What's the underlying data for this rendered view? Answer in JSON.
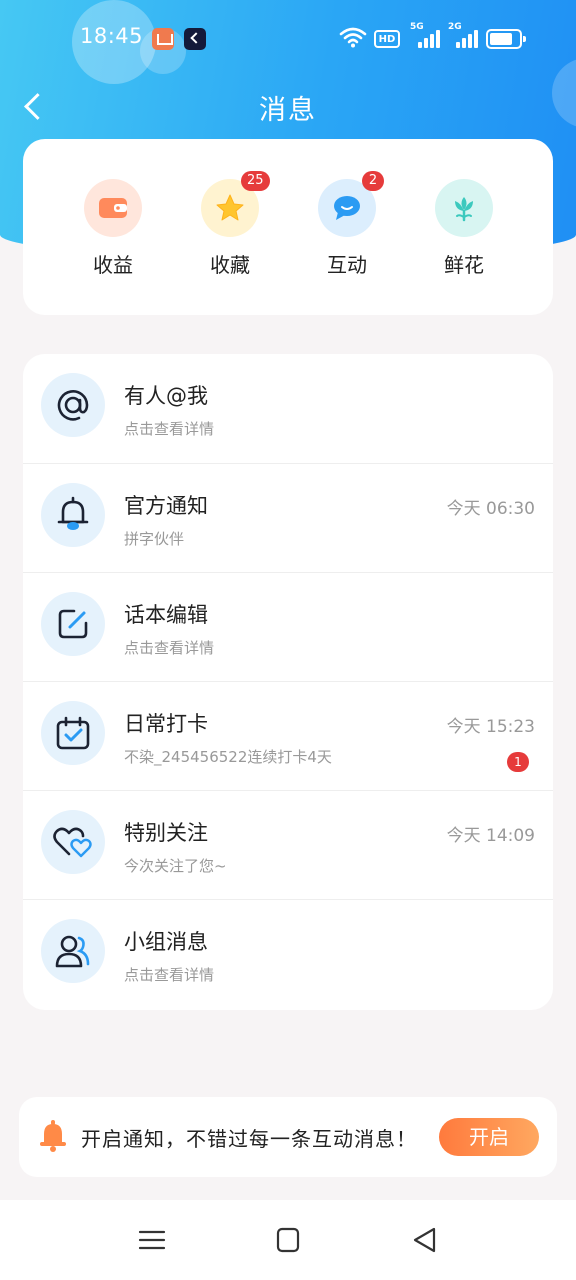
{
  "status_bar": {
    "time": "18:45",
    "hd_label": "HD",
    "sim1": "5G",
    "sim2": "2G"
  },
  "header": {
    "title": "消息"
  },
  "categories": [
    {
      "label": "收益",
      "icon": "wallet-icon",
      "badge": ""
    },
    {
      "label": "收藏",
      "icon": "star-icon",
      "badge": "25"
    },
    {
      "label": "互动",
      "icon": "chat-bubble-icon",
      "badge": "2"
    },
    {
      "label": "鲜花",
      "icon": "flower-icon",
      "badge": ""
    }
  ],
  "messages": [
    {
      "title": "有人@我",
      "subtitle": "点击查看详情",
      "time": "",
      "badge": "",
      "icon": "at-icon"
    },
    {
      "title": "官方通知",
      "subtitle": "拼字伙伴",
      "time": "今天 06:30",
      "badge": "",
      "icon": "bell-icon"
    },
    {
      "title": "话本编辑",
      "subtitle": "点击查看详情",
      "time": "",
      "badge": "",
      "icon": "edit-icon"
    },
    {
      "title": "日常打卡",
      "subtitle": "不染_245456522连续打卡4天",
      "time": "今天 15:23",
      "badge": "1",
      "icon": "calendar-check-icon"
    },
    {
      "title": "特别关注",
      "subtitle": "今次关注了您~",
      "time": "今天 14:09",
      "badge": "",
      "icon": "hearts-icon"
    },
    {
      "title": "小组消息",
      "subtitle": "点击查看详情",
      "time": "",
      "badge": "",
      "icon": "group-icon"
    }
  ],
  "notify_banner": {
    "text": "开启通知，不错过每一条互动消息！",
    "button": "开启"
  },
  "colors": {
    "header_blue": "#2aa6f5",
    "badge_red": "#e63b3b",
    "button_orange": "#ff8a47",
    "icon_bg": "#e5f2fc"
  }
}
